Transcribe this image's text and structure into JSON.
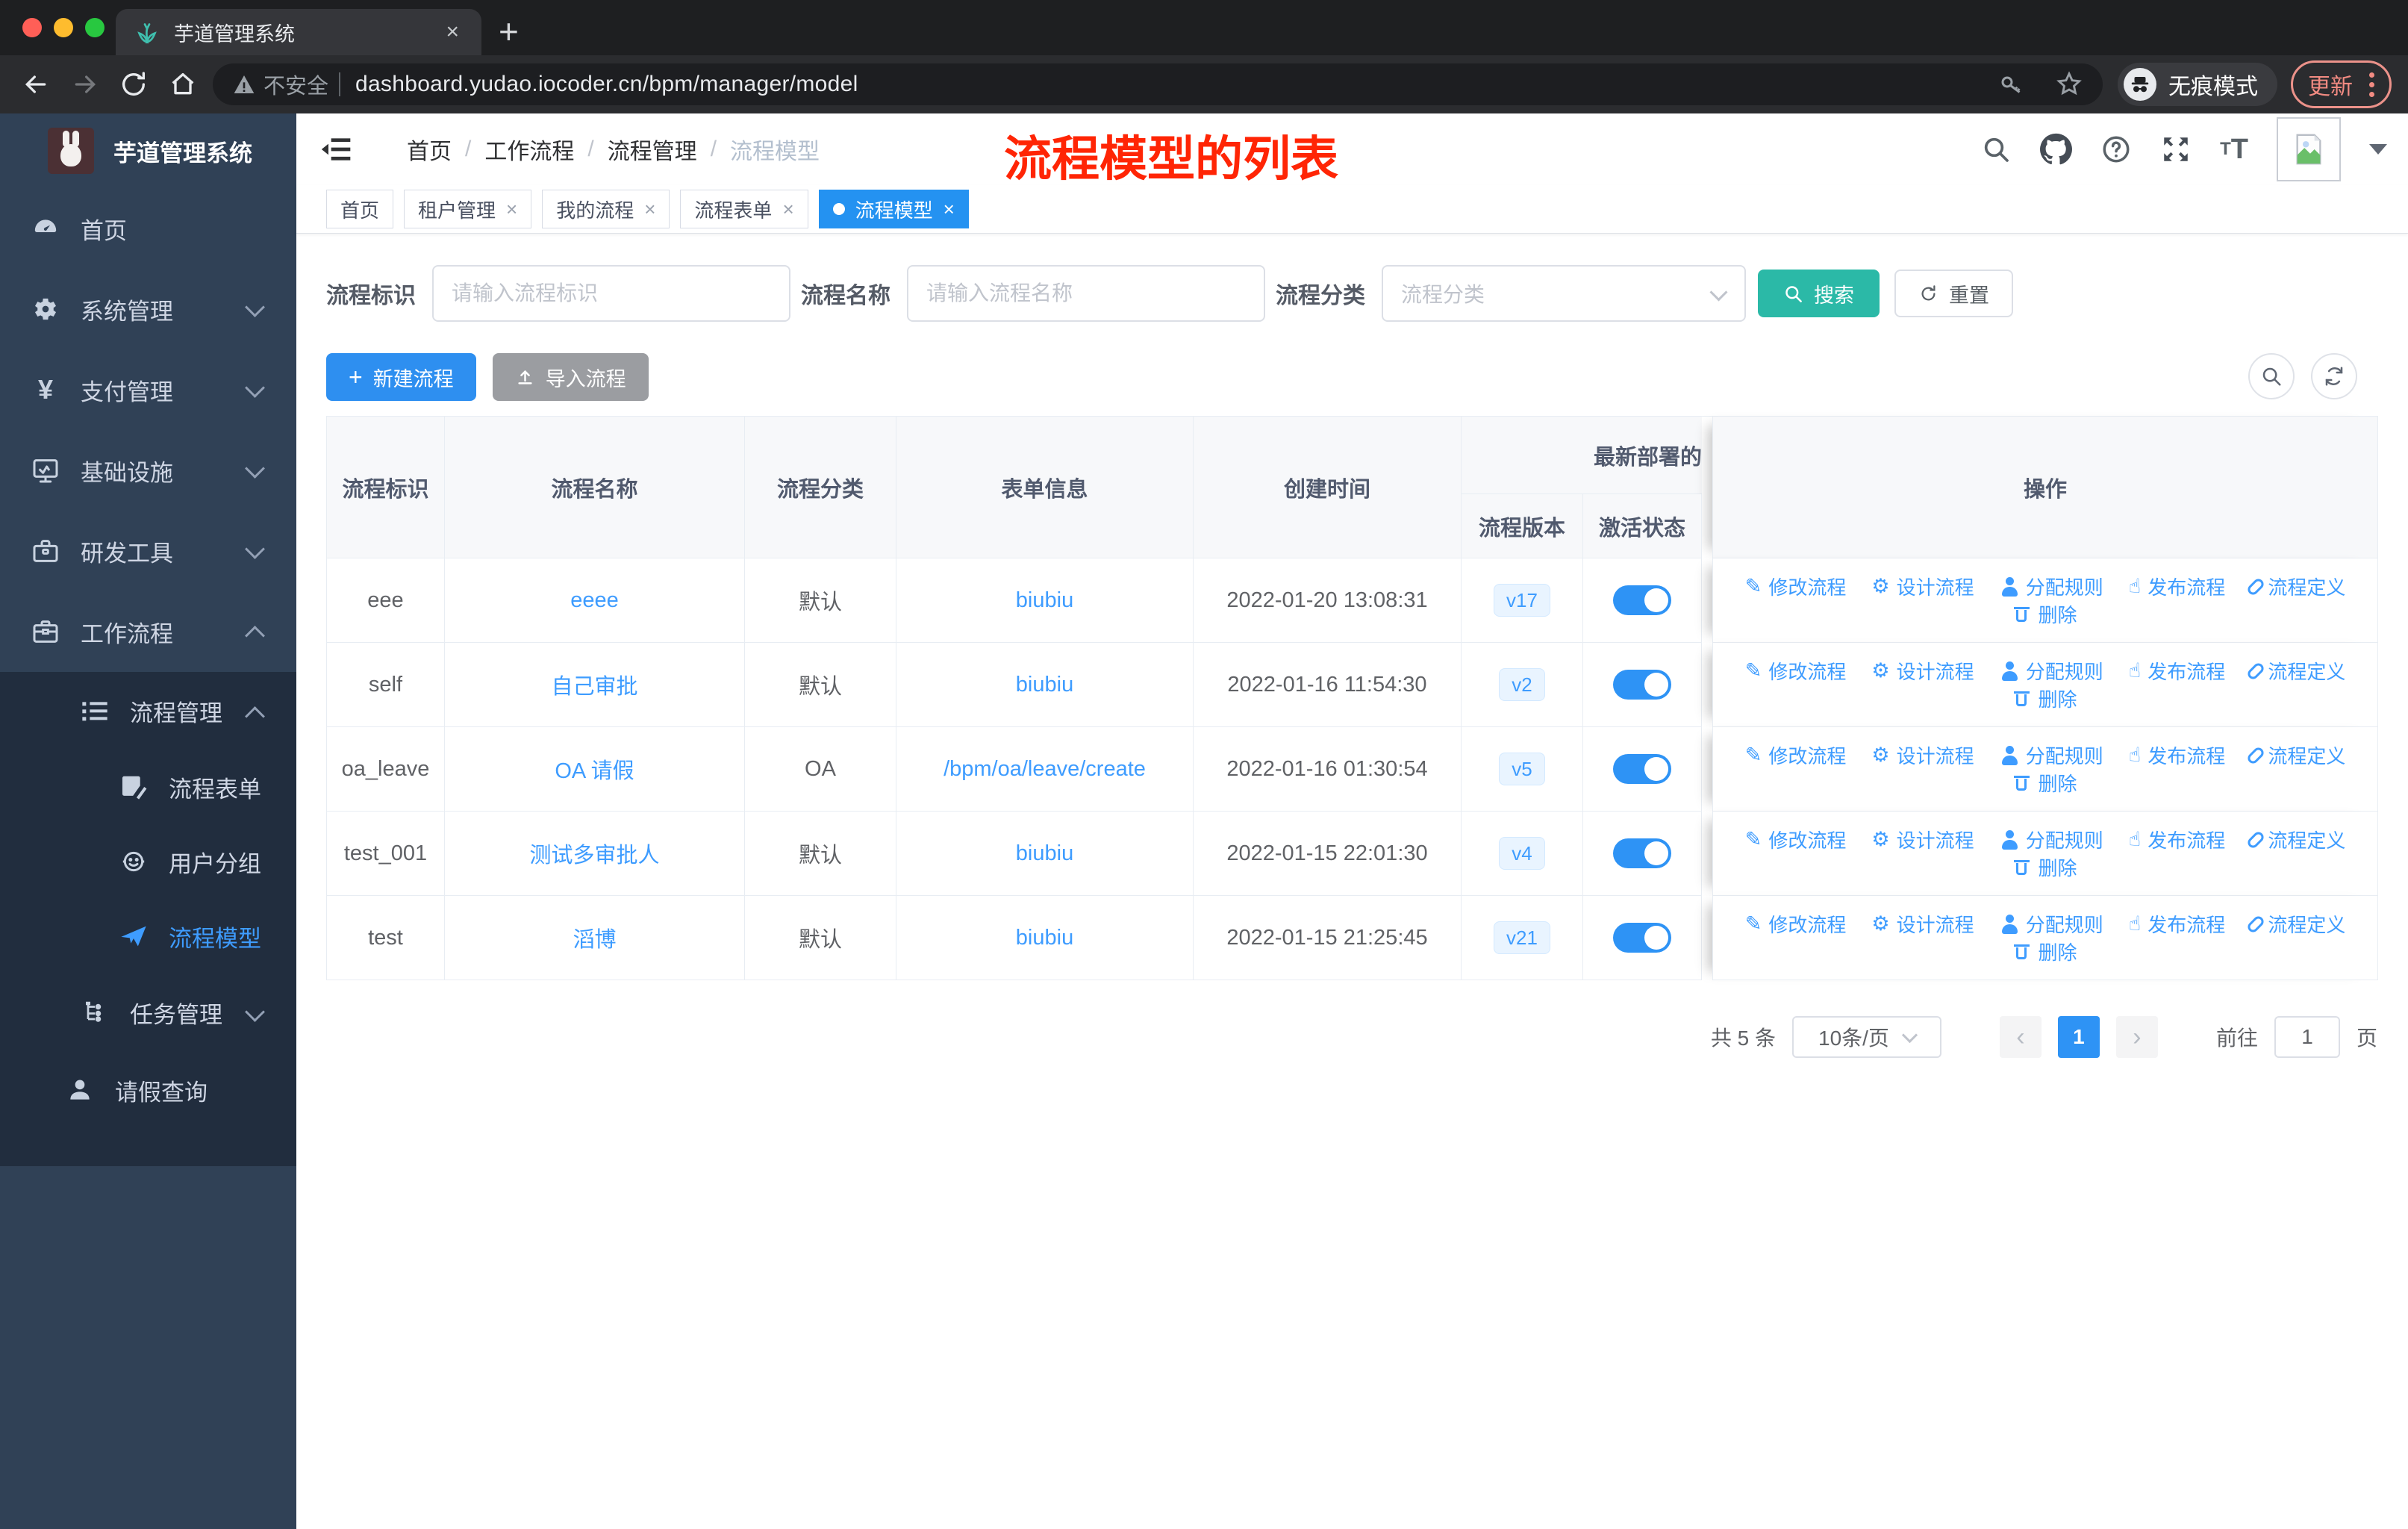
{
  "colors": {
    "accent_blue": "#2e8ff0",
    "link_blue": "#3e9cff",
    "search_teal": "#2bb9a7",
    "annotation_red": "#ff2505",
    "sidebar_bg": "#304156",
    "submenu_bg": "#212d3e",
    "active_tag_bg": "#2492f1",
    "update_salmon": "#f28b82"
  },
  "browser": {
    "tab_title": "芋道管理系统",
    "new_tab_glyph": "+",
    "close_glyph": "×",
    "security_text": "不安全",
    "url": "dashboard.yudao.iocoder.cn/bpm/manager/model",
    "incognito_label": "无痕模式",
    "update_label": "更新"
  },
  "sidebar": {
    "app_title": "芋道管理系统",
    "items": [
      {
        "label": "首页",
        "icon": "dashboard-icon"
      },
      {
        "label": "系统管理",
        "icon": "gear-icon"
      },
      {
        "label": "支付管理",
        "icon": "yen-icon"
      },
      {
        "label": "基础设施",
        "icon": "monitor-icon"
      },
      {
        "label": "研发工具",
        "icon": "toolbox-icon"
      },
      {
        "label": "工作流程",
        "icon": "briefcase-icon"
      },
      {
        "label": "流程管理",
        "icon": "list-icon"
      },
      {
        "label": "流程表单",
        "icon": "form-icon"
      },
      {
        "label": "用户分组",
        "icon": "group-icon"
      },
      {
        "label": "流程模型",
        "icon": "paper-plane-icon",
        "active": true
      },
      {
        "label": "任务管理",
        "icon": "tree-icon"
      },
      {
        "label": "请假查询",
        "icon": "user-icon"
      }
    ]
  },
  "header": {
    "breadcrumb": [
      "首页",
      "工作流程",
      "流程管理",
      "流程模型"
    ],
    "separator": "/",
    "annotation": "流程模型的列表"
  },
  "tags": [
    {
      "label": "首页"
    },
    {
      "label": "租户管理"
    },
    {
      "label": "我的流程"
    },
    {
      "label": "流程表单"
    },
    {
      "label": "流程模型"
    }
  ],
  "filters": {
    "id_label": "流程标识",
    "id_placeholder": "请输入流程标识",
    "name_label": "流程名称",
    "name_placeholder": "请输入流程名称",
    "category_label": "流程分类",
    "category_placeholder": "流程分类",
    "search_label": "搜索",
    "reset_label": "重置"
  },
  "toolbar": {
    "create_label": "新建流程",
    "import_label": "导入流程"
  },
  "table": {
    "col_id": "流程标识",
    "col_name": "流程名称",
    "col_category": "流程分类",
    "col_form": "表单信息",
    "col_created": "创建时间",
    "group_deploy": "最新部署的",
    "col_version": "流程版本",
    "col_active": "激活状态",
    "col_actions": "操作",
    "actions": [
      "修改流程",
      "设计流程",
      "分配规则",
      "发布流程",
      "流程定义",
      "删除"
    ],
    "rows": [
      {
        "id": "eee",
        "name": "eeee",
        "category": "默认",
        "form": "biubiu",
        "created": "2022-01-20 13:08:31",
        "version": "v17",
        "active": true
      },
      {
        "id": "self",
        "name": "自己审批",
        "category": "默认",
        "form": "biubiu",
        "created": "2022-01-16 11:54:30",
        "version": "v2",
        "active": true
      },
      {
        "id": "oa_leave",
        "name": "OA 请假",
        "category": "OA",
        "form": "/bpm/oa/leave/create",
        "created": "2022-01-16 01:30:54",
        "version": "v5",
        "active": true
      },
      {
        "id": "test_001",
        "name": "测试多审批人",
        "category": "默认",
        "form": "biubiu",
        "created": "2022-01-15 22:01:30",
        "version": "v4",
        "active": true
      },
      {
        "id": "test",
        "name": "滔博",
        "category": "默认",
        "form": "biubiu",
        "created": "2022-01-15 21:25:45",
        "version": "v21",
        "active": true
      }
    ]
  },
  "pagination": {
    "total": "共 5 条",
    "page_size": "10条/页",
    "prev": "‹",
    "page": "1",
    "next": "›",
    "goto_label": "前往",
    "goto_value": "1",
    "unit": "页"
  }
}
